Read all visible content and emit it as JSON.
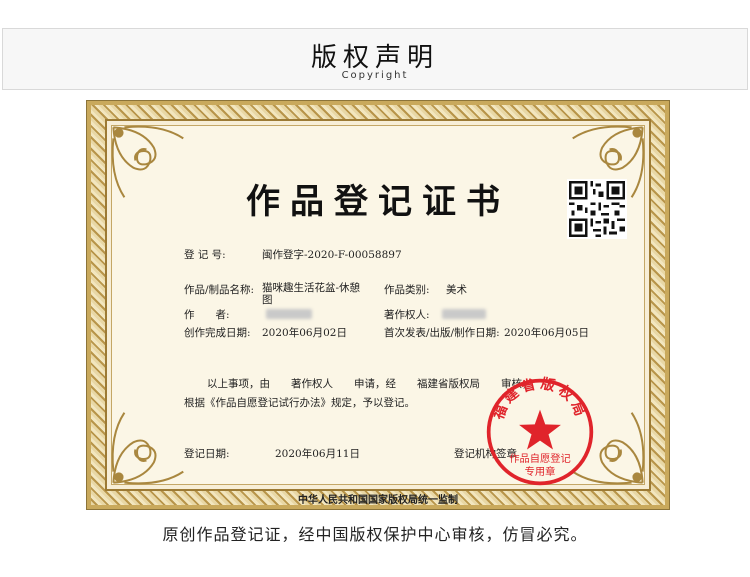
{
  "header": {
    "title": "版权声明",
    "subtitle": "Copyright"
  },
  "certificate": {
    "title": "作品登记证书",
    "reg_no_label": "登 记 号:",
    "reg_no_value": "闽作登字-2020-F-00058897",
    "work_name_label": "作品/制品名称:",
    "work_name_value": "猫咪趣生活花盆-休憩图",
    "category_label": "作品类别:",
    "category_value": "美术",
    "author_label": "作　　者:",
    "owner_label": "著作权人:",
    "created_label": "创作完成日期:",
    "created_value": "2020年06月02日",
    "published_label": "首次发表/出版/制作日期:",
    "published_value": "2020年06月05日",
    "statement_line1": "以上事项，由　　著作权人　　申请，经　　福建省版权局　　审核，",
    "statement_line2": "根据《作品自愿登记试行办法》规定，予以登记。",
    "reg_date_label": "登记日期:",
    "reg_date_value": "2020年06月11日",
    "agency_label": "登记机构签章",
    "footer": "中华人民共和国国家版权局统一监制",
    "seal_arc_text": "福建省版权局",
    "seal_line1": "作品自愿登记",
    "seal_line2": "专用章"
  },
  "caption": "原创作品登记证，经中国版权保护中心审核，仿冒必究。",
  "colors": {
    "seal_red": "#e0242b",
    "frame_gold": "#c9a95c"
  },
  "icons": [
    "qr-code-icon",
    "seal-star-icon",
    "corner-ornament-icon"
  ]
}
